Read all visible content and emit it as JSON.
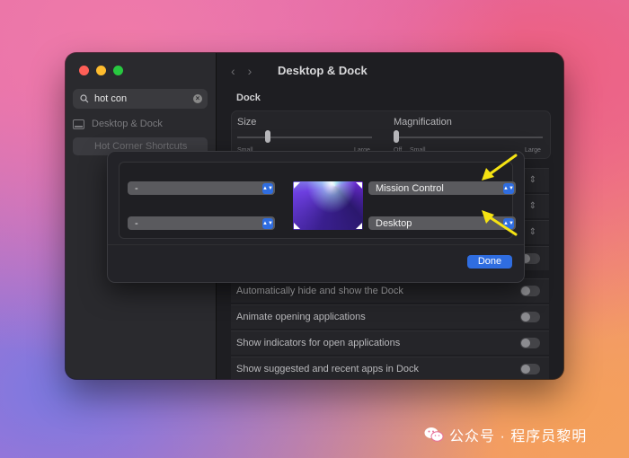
{
  "search": {
    "value": "hot con"
  },
  "sidebar": {
    "items": [
      {
        "label": "Desktop & Dock"
      },
      {
        "label": "Hot Corner Shortcuts"
      }
    ]
  },
  "header": {
    "title": "Desktop & Dock"
  },
  "dock": {
    "section_label": "Dock",
    "size_label": "Size",
    "size_small": "Small",
    "size_large": "Large",
    "size_level": 0.2,
    "magnification_label": "Magnification",
    "mag_off": "Off",
    "mag_small": "Small",
    "mag_large": "Large",
    "magnification_level": 0.0,
    "settings": [
      {
        "label": "Automatically hide and show the Dock"
      },
      {
        "label": "Animate opening applications"
      },
      {
        "label": "Show indicators for open applications"
      },
      {
        "label": "Show suggested and recent apps in Dock"
      }
    ]
  },
  "hot_corners": {
    "top_left": "-",
    "bottom_left": "-",
    "top_right": "Mission Control",
    "bottom_right": "Desktop",
    "done_label": "Done"
  },
  "watermark": {
    "text": "公众号 · 程序员黎明"
  },
  "colors": {
    "accent": "#2f6de0",
    "arrow": "#f5e313"
  }
}
